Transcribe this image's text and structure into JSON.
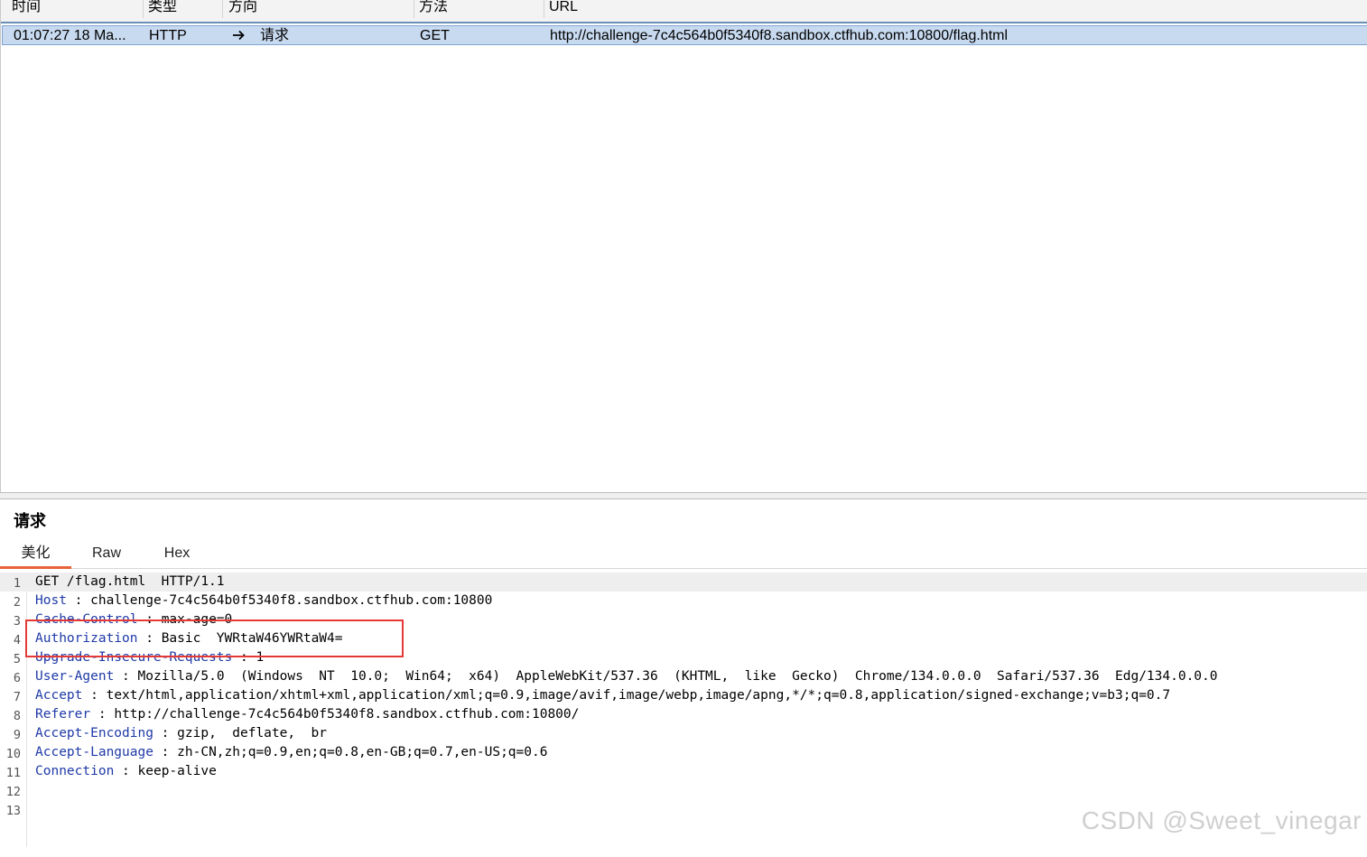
{
  "history": {
    "columns": [
      "时间",
      "类型",
      "方向",
      "方法",
      "URL"
    ],
    "rows": [
      {
        "time": "01:07:27 18 Ma...",
        "type": "HTTP",
        "direction_icon": "arrow-right-icon",
        "direction": "请求",
        "method": "GET",
        "url": "http://challenge-7c4c564b0f5340f8.sandbox.ctfhub.com:10800/flag.html"
      }
    ]
  },
  "request_panel": {
    "title": "请求",
    "tabs": [
      "美化",
      "Raw",
      "Hex"
    ],
    "active_tab": "美化",
    "line_numbers": [
      "1",
      "2",
      "3",
      "4",
      "5",
      "6",
      "7",
      "8",
      "9",
      "10",
      "11",
      "12",
      "13"
    ],
    "request_line": "GET /flag.html  HTTP/1.1",
    "headers": [
      {
        "name": "Host",
        "sep": " : ",
        "value": "challenge-7c4c564b0f5340f8.sandbox.ctfhub.com:10800"
      },
      {
        "name": "Cache-Control",
        "sep": " : ",
        "value": "max-age=0"
      },
      {
        "name": "Authorization",
        "sep": " : ",
        "value": "Basic  YWRtaW46YWRtaW4="
      },
      {
        "name": "Upgrade-Insecure-Requests",
        "sep": " : ",
        "value": "1"
      },
      {
        "name": "User-Agent",
        "sep": " : ",
        "value": "Mozilla/5.0  (Windows  NT  10.0;  Win64;  x64)  AppleWebKit/537.36  (KHTML,  like  Gecko)  Chrome/134.0.0.0  Safari/537.36  Edg/134.0.0.0"
      },
      {
        "name": "Accept",
        "sep": " : ",
        "value": "text/html,application/xhtml+xml,application/xml;q=0.9,image/avif,image/webp,image/apng,*/*;q=0.8,application/signed-exchange;v=b3;q=0.7"
      },
      {
        "name": "Referer",
        "sep": " : ",
        "value": "http://challenge-7c4c564b0f5340f8.sandbox.ctfhub.com:10800/"
      },
      {
        "name": "Accept-Encoding",
        "sep": " : ",
        "value": "gzip,  deflate,  br"
      },
      {
        "name": "Accept-Language",
        "sep": " : ",
        "value": "zh-CN,zh;q=0.9,en;q=0.8,en-GB;q=0.7,en-US;q=0.6"
      },
      {
        "name": "Connection",
        "sep": " : ",
        "value": "keep-alive"
      }
    ]
  },
  "watermark": "CSDN @Sweet_vinegar",
  "colors": {
    "header_name": "#1f3aa8",
    "selected_row": "#c8daf0",
    "active_tab_underline": "#e8623a",
    "highlight_box": "#e53935"
  }
}
